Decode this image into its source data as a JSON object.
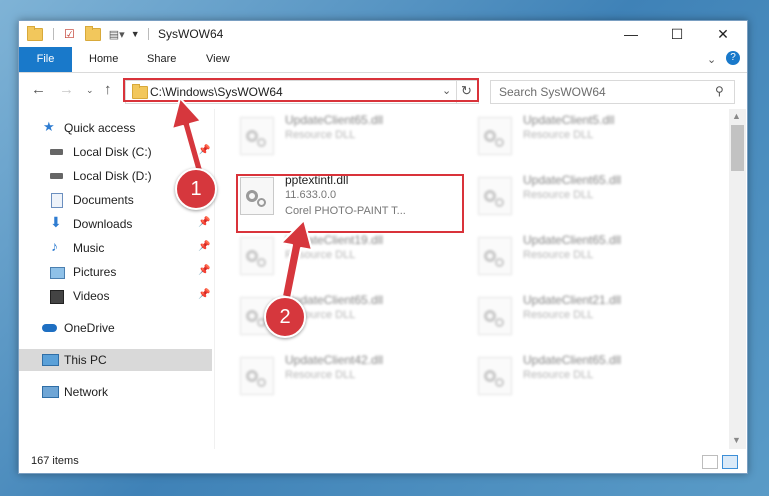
{
  "window": {
    "title": "SysWOW64"
  },
  "ribbon": {
    "tabs": [
      "File",
      "Home",
      "Share",
      "View"
    ]
  },
  "nav": {
    "path": "C:\\Windows\\SysWOW64",
    "search_placeholder": "Search SysWOW64"
  },
  "sidebar": {
    "items": [
      {
        "label": "Quick access"
      },
      {
        "label": "Local Disk (C:)"
      },
      {
        "label": "Local Disk (D:)"
      },
      {
        "label": "Documents"
      },
      {
        "label": "Downloads"
      },
      {
        "label": "Music"
      },
      {
        "label": "Pictures"
      },
      {
        "label": "Videos"
      },
      {
        "label": "OneDrive"
      },
      {
        "label": "This PC"
      },
      {
        "label": "Network"
      }
    ]
  },
  "files": [
    {
      "name": "UpdateClient65.dll",
      "desc": "Resource DLL"
    },
    {
      "name": "UpdateClient5.dll",
      "desc": "Resource DLL"
    },
    {
      "name": "pptextintl.dll",
      "desc": "11.633.0.0",
      "sub": "Corel PHOTO-PAINT T..."
    },
    {
      "name": "UpdateClient65.dll",
      "desc": "Resource DLL"
    },
    {
      "name": "UpdateClient19.dll",
      "desc": "Resource DLL"
    },
    {
      "name": "UpdateClient65.dll",
      "desc": "Resource DLL"
    },
    {
      "name": "UpdateClient65.dll",
      "desc": "Resource DLL"
    },
    {
      "name": "UpdateClient21.dll",
      "desc": "Resource DLL"
    },
    {
      "name": "UpdateClient42.dll",
      "desc": "Resource DLL"
    },
    {
      "name": "UpdateClient65.dll",
      "desc": "Resource DLL"
    }
  ],
  "status": {
    "count": "167 items"
  },
  "annotations": {
    "step1": "1",
    "step2": "2"
  },
  "colors": {
    "accent": "#1979ca",
    "highlight": "#d9333a"
  }
}
